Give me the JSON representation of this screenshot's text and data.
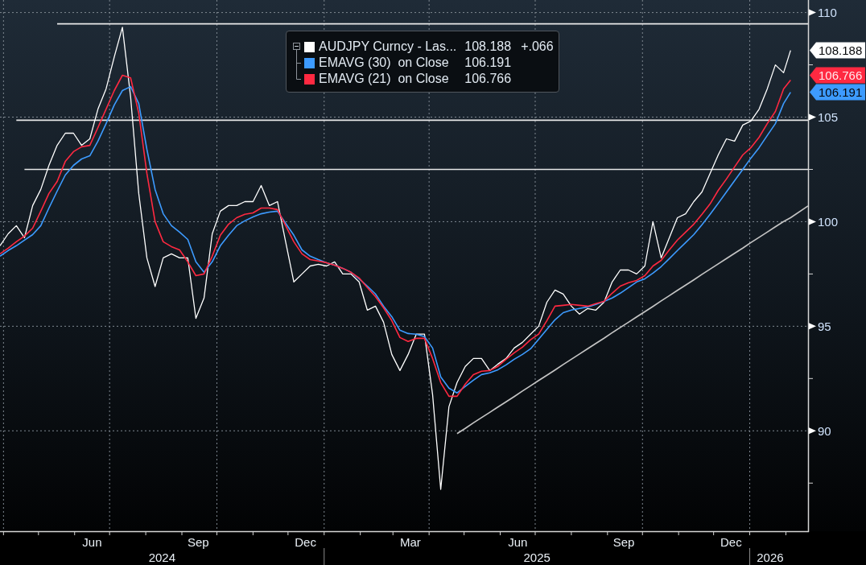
{
  "chart": {
    "legend": {
      "expanded": true,
      "rows": [
        {
          "value": "108.188",
          "change": "+.066"
        },
        {
          "value": "106.191"
        },
        {
          "value": "106.766"
        }
      ]
    },
    "value_tags": [
      {
        "label": "108.188",
        "color": "#ffffff"
      },
      {
        "label": "106.766",
        "color": "#ff2941"
      },
      {
        "label": "106.191",
        "color": "#3d9bff"
      }
    ],
    "year_labels": [
      "2024",
      "2025",
      "2026"
    ],
    "chart_data": {
      "type": "line",
      "grid": true,
      "x": [
        "2024-03-29",
        "2024-04-05",
        "2024-04-12",
        "2024-04-19",
        "2024-04-26",
        "2024-05-03",
        "2024-05-10",
        "2024-05-17",
        "2024-05-24",
        "2024-05-31",
        "2024-06-07",
        "2024-06-14",
        "2024-06-21",
        "2024-06-28",
        "2024-07-05",
        "2024-07-12",
        "2024-07-19",
        "2024-07-26",
        "2024-08-02",
        "2024-08-09",
        "2024-08-16",
        "2024-08-23",
        "2024-08-30",
        "2024-09-06",
        "2024-09-13",
        "2024-09-20",
        "2024-09-27",
        "2024-10-04",
        "2024-10-11",
        "2024-10-18",
        "2024-10-25",
        "2024-11-01",
        "2024-11-08",
        "2024-11-15",
        "2024-11-22",
        "2024-11-29",
        "2024-12-06",
        "2024-12-13",
        "2024-12-20",
        "2024-12-27",
        "2025-01-03",
        "2025-01-10",
        "2025-01-17",
        "2025-01-24",
        "2025-01-31",
        "2025-02-07",
        "2025-02-14",
        "2025-02-21",
        "2025-02-28",
        "2025-03-07",
        "2025-03-14",
        "2025-03-21",
        "2025-03-28",
        "2025-04-04",
        "2025-04-11",
        "2025-04-18",
        "2025-04-25",
        "2025-05-02",
        "2025-05-09",
        "2025-05-16",
        "2025-05-23",
        "2025-05-30",
        "2025-06-06",
        "2025-06-13",
        "2025-06-20",
        "2025-06-27",
        "2025-07-04",
        "2025-07-11",
        "2025-07-18",
        "2025-07-25",
        "2025-08-01",
        "2025-08-08",
        "2025-08-15",
        "2025-08-22",
        "2025-08-29",
        "2025-09-05",
        "2025-09-12",
        "2025-09-19",
        "2025-09-26",
        "2025-10-03",
        "2025-10-10",
        "2025-10-17",
        "2025-10-24",
        "2025-10-31",
        "2025-11-07",
        "2025-11-14",
        "2025-11-21",
        "2025-11-28",
        "2025-12-05",
        "2025-12-12",
        "2025-12-19",
        "2025-12-26",
        "2026-01-02",
        "2026-01-09",
        "2026-01-16",
        "2026-01-23",
        "2026-01-30",
        "2026-02-05",
        "2026-02-20"
      ],
      "series": [
        {
          "name": "AUDJPY Curncy - Las...",
          "color": "#ffffff",
          "values": [
            98.85,
            99.42,
            99.81,
            99.23,
            100.77,
            101.54,
            102.69,
            103.65,
            104.23,
            104.23,
            103.65,
            103.96,
            105.38,
            106.35,
            107.88,
            109.3,
            105.96,
            101.35,
            98.27,
            96.9,
            98.27,
            98.46,
            98.27,
            98.27,
            95.38,
            96.35,
            99.42,
            100.5,
            100.77,
            100.77,
            100.96,
            100.96,
            101.73,
            100.77,
            100.96,
            99.04,
            97.12,
            97.5,
            97.88,
            97.96,
            97.88,
            98.08,
            97.5,
            97.5,
            97.12,
            95.77,
            95.96,
            95.19,
            93.65,
            92.88,
            93.65,
            94.62,
            94.62,
            91.73,
            87.2,
            91.15,
            92.31,
            93.08,
            93.46,
            93.46,
            92.88,
            93.19,
            93.46,
            93.96,
            94.23,
            94.62,
            95.0,
            96.15,
            96.73,
            96.54,
            95.96,
            95.58,
            95.85,
            95.77,
            96.15,
            97.12,
            97.69,
            97.69,
            97.5,
            97.88,
            100.0,
            98.27,
            99.23,
            100.19,
            100.38,
            100.96,
            101.42,
            102.31,
            103.19,
            103.96,
            103.85,
            104.62,
            104.81,
            105.38,
            106.35,
            107.5,
            107.12,
            108.19,
            null
          ]
        },
        {
          "name": "EMAVG (30)  on Close",
          "color": "#3d9bff",
          "values": [
            98.35,
            98.62,
            98.85,
            99.12,
            99.38,
            99.81,
            100.65,
            101.46,
            102.23,
            102.69,
            103.0,
            103.15,
            103.85,
            104.69,
            105.58,
            106.27,
            106.46,
            105.65,
            103.46,
            101.54,
            100.38,
            99.81,
            99.5,
            99.15,
            98.08,
            97.58,
            98.08,
            98.85,
            99.35,
            99.81,
            100.04,
            100.23,
            100.38,
            100.46,
            100.5,
            99.92,
            99.35,
            98.65,
            98.35,
            98.19,
            98.04,
            97.92,
            97.77,
            97.58,
            97.27,
            96.92,
            96.54,
            95.96,
            95.46,
            94.81,
            94.65,
            94.62,
            94.5,
            93.96,
            92.58,
            92.04,
            91.81,
            92.12,
            92.42,
            92.69,
            92.77,
            92.92,
            93.15,
            93.42,
            93.65,
            93.92,
            94.38,
            94.85,
            95.31,
            95.65,
            95.77,
            95.85,
            95.92,
            96.04,
            96.19,
            96.35,
            96.58,
            96.85,
            97.12,
            97.27,
            97.54,
            97.85,
            98.23,
            98.62,
            99.0,
            99.38,
            99.85,
            100.35,
            100.88,
            101.42,
            101.96,
            102.5,
            103.04,
            103.54,
            104.12,
            104.69,
            105.65,
            106.19,
            null
          ]
        },
        {
          "name": "EMAVG (21)  on Close",
          "color": "#ff2941",
          "values": [
            98.46,
            98.73,
            99.04,
            99.31,
            99.69,
            100.5,
            101.35,
            101.92,
            102.88,
            103.35,
            103.58,
            103.65,
            104.5,
            105.38,
            106.27,
            107.0,
            106.88,
            105.19,
            102.31,
            100.0,
            99.04,
            98.81,
            98.65,
            98.08,
            97.42,
            97.5,
            98.35,
            99.35,
            99.88,
            100.19,
            100.35,
            100.42,
            100.65,
            100.65,
            100.58,
            99.81,
            99.04,
            98.46,
            98.19,
            98.12,
            98.04,
            97.92,
            97.77,
            97.58,
            97.31,
            96.85,
            96.42,
            95.88,
            95.27,
            94.46,
            94.27,
            94.42,
            94.42,
            93.46,
            92.31,
            91.65,
            91.65,
            92.23,
            92.69,
            92.85,
            92.88,
            93.08,
            93.42,
            93.73,
            94.0,
            94.35,
            94.62,
            95.27,
            95.96,
            96.0,
            96.04,
            96.0,
            95.96,
            96.08,
            96.19,
            96.58,
            96.92,
            97.08,
            97.19,
            97.42,
            97.88,
            98.15,
            98.65,
            99.12,
            99.5,
            99.88,
            100.35,
            100.85,
            101.5,
            102.04,
            102.62,
            103.19,
            103.54,
            104.04,
            104.69,
            105.27,
            106.35,
            106.77,
            null
          ]
        },
        {
          "color": "#e9e9e9",
          "values": [
            null,
            null,
            null,
            null,
            null,
            null,
            null,
            109.46,
            109.46,
            109.46,
            109.46,
            109.46,
            109.46,
            109.46,
            109.46,
            109.46,
            109.46,
            109.46,
            109.46,
            109.46,
            109.46,
            109.46,
            109.46,
            109.46,
            109.46,
            109.46,
            109.46,
            109.46,
            109.46,
            109.46,
            109.46,
            109.46,
            109.46,
            109.46,
            109.46,
            109.46,
            109.46,
            109.46,
            109.46,
            109.46,
            109.46,
            109.46,
            109.46,
            109.46,
            109.46,
            109.46,
            109.46,
            109.46,
            109.46,
            109.46,
            109.46,
            109.46,
            109.46,
            109.46,
            109.46,
            109.46,
            109.46,
            109.46,
            109.46,
            109.46,
            109.46,
            109.46,
            109.46,
            109.46,
            109.46,
            109.46,
            109.46,
            109.46,
            109.46,
            109.46,
            109.46,
            109.46,
            109.46,
            109.46,
            109.46,
            109.46,
            109.46,
            109.46,
            109.46,
            109.46,
            109.46,
            109.46,
            109.46,
            109.46,
            109.46,
            109.46,
            109.46,
            109.46,
            109.46,
            109.46,
            109.46,
            109.46,
            109.46,
            109.46,
            109.46,
            109.46,
            109.46,
            109.46,
            109.46
          ]
        },
        {
          "color": "#e8e8e8",
          "values": [
            null,
            null,
            104.85,
            104.85,
            104.85,
            104.85,
            104.85,
            104.85,
            104.85,
            104.85,
            104.85,
            104.85,
            104.85,
            104.85,
            104.85,
            104.85,
            104.85,
            104.85,
            104.85,
            104.85,
            104.85,
            104.85,
            104.85,
            104.85,
            104.85,
            104.85,
            104.85,
            104.85,
            104.85,
            104.85,
            104.85,
            104.85,
            104.85,
            104.85,
            104.85,
            104.85,
            104.85,
            104.85,
            104.85,
            104.85,
            104.85,
            104.85,
            104.85,
            104.85,
            104.85,
            104.85,
            104.85,
            104.85,
            104.85,
            104.85,
            104.85,
            104.85,
            104.85,
            104.85,
            104.85,
            104.85,
            104.85,
            104.85,
            104.85,
            104.85,
            104.85,
            104.85,
            104.85,
            104.85,
            104.85,
            104.85,
            104.85,
            104.85,
            104.85,
            104.85,
            104.85,
            104.85,
            104.85,
            104.85,
            104.85,
            104.85,
            104.85,
            104.85,
            104.85,
            104.85,
            104.85,
            104.85,
            104.85,
            104.85,
            104.85,
            104.85,
            104.85,
            104.85,
            104.85,
            104.85,
            104.85,
            104.85,
            104.85,
            104.85,
            104.85,
            104.85,
            104.85,
            104.85,
            104.85
          ]
        },
        {
          "color": "#e7e7e7",
          "values": [
            null,
            null,
            null,
            102.5,
            102.5,
            102.5,
            102.5,
            102.5,
            102.5,
            102.5,
            102.5,
            102.5,
            102.5,
            102.5,
            102.5,
            102.5,
            102.5,
            102.5,
            102.5,
            102.5,
            102.5,
            102.5,
            102.5,
            102.5,
            102.5,
            102.5,
            102.5,
            102.5,
            102.5,
            102.5,
            102.5,
            102.5,
            102.5,
            102.5,
            102.5,
            102.5,
            102.5,
            102.5,
            102.5,
            102.5,
            102.5,
            102.5,
            102.5,
            102.5,
            102.5,
            102.5,
            102.5,
            102.5,
            102.5,
            102.5,
            102.5,
            102.5,
            102.5,
            102.5,
            102.5,
            102.5,
            102.5,
            102.5,
            102.5,
            102.5,
            102.5,
            102.5,
            102.5,
            102.5,
            102.5,
            102.5,
            102.5,
            102.5,
            102.5,
            102.5,
            102.5,
            102.5,
            102.5,
            102.5,
            102.5,
            102.5,
            102.5,
            102.5,
            102.5,
            102.5,
            102.5,
            102.5,
            102.5,
            102.5,
            102.5,
            102.5,
            102.5,
            102.5,
            102.5,
            102.5,
            102.5,
            102.5,
            102.5,
            102.5,
            102.5,
            102.5,
            102.5,
            102.5,
            102.5
          ]
        },
        {
          "color": "#c4c4c4",
          "values": [
            null,
            null,
            null,
            null,
            null,
            null,
            null,
            null,
            null,
            null,
            null,
            null,
            null,
            null,
            null,
            null,
            null,
            null,
            null,
            null,
            null,
            null,
            null,
            null,
            null,
            null,
            null,
            null,
            null,
            null,
            null,
            null,
            null,
            null,
            null,
            null,
            null,
            null,
            null,
            null,
            null,
            null,
            null,
            null,
            null,
            null,
            null,
            null,
            null,
            null,
            null,
            null,
            null,
            null,
            null,
            null,
            89.87,
            90.12,
            90.38,
            90.63,
            90.88,
            91.14,
            91.39,
            91.64,
            91.9,
            92.15,
            92.41,
            92.66,
            92.91,
            93.17,
            93.42,
            93.67,
            93.93,
            94.18,
            94.43,
            94.69,
            94.94,
            95.19,
            95.45,
            95.7,
            95.95,
            96.21,
            96.46,
            96.72,
            96.97,
            97.22,
            97.48,
            97.73,
            97.98,
            98.24,
            98.49,
            98.74,
            99.0,
            99.25,
            99.5,
            99.76,
            100.01,
            100.19,
            100.75
          ]
        }
      ],
      "xlim": [
        "2024-03-29",
        "2026-02-20"
      ],
      "ylim": [
        85.2,
        110.6
      ],
      "xticks": [
        {
          "value": "2024-06-16",
          "label": "Jun"
        },
        {
          "value": "2024-09-15",
          "label": "Sep"
        },
        {
          "value": "2024-12-16",
          "label": "Dec"
        },
        {
          "value": "2025-03-16",
          "label": "Mar"
        },
        {
          "value": "2025-06-16",
          "label": "Jun"
        },
        {
          "value": "2025-09-15",
          "label": "Sep"
        },
        {
          "value": "2025-12-16",
          "label": "Dec"
        }
      ],
      "yticks": [
        90,
        95,
        100,
        105,
        110
      ]
    }
  }
}
